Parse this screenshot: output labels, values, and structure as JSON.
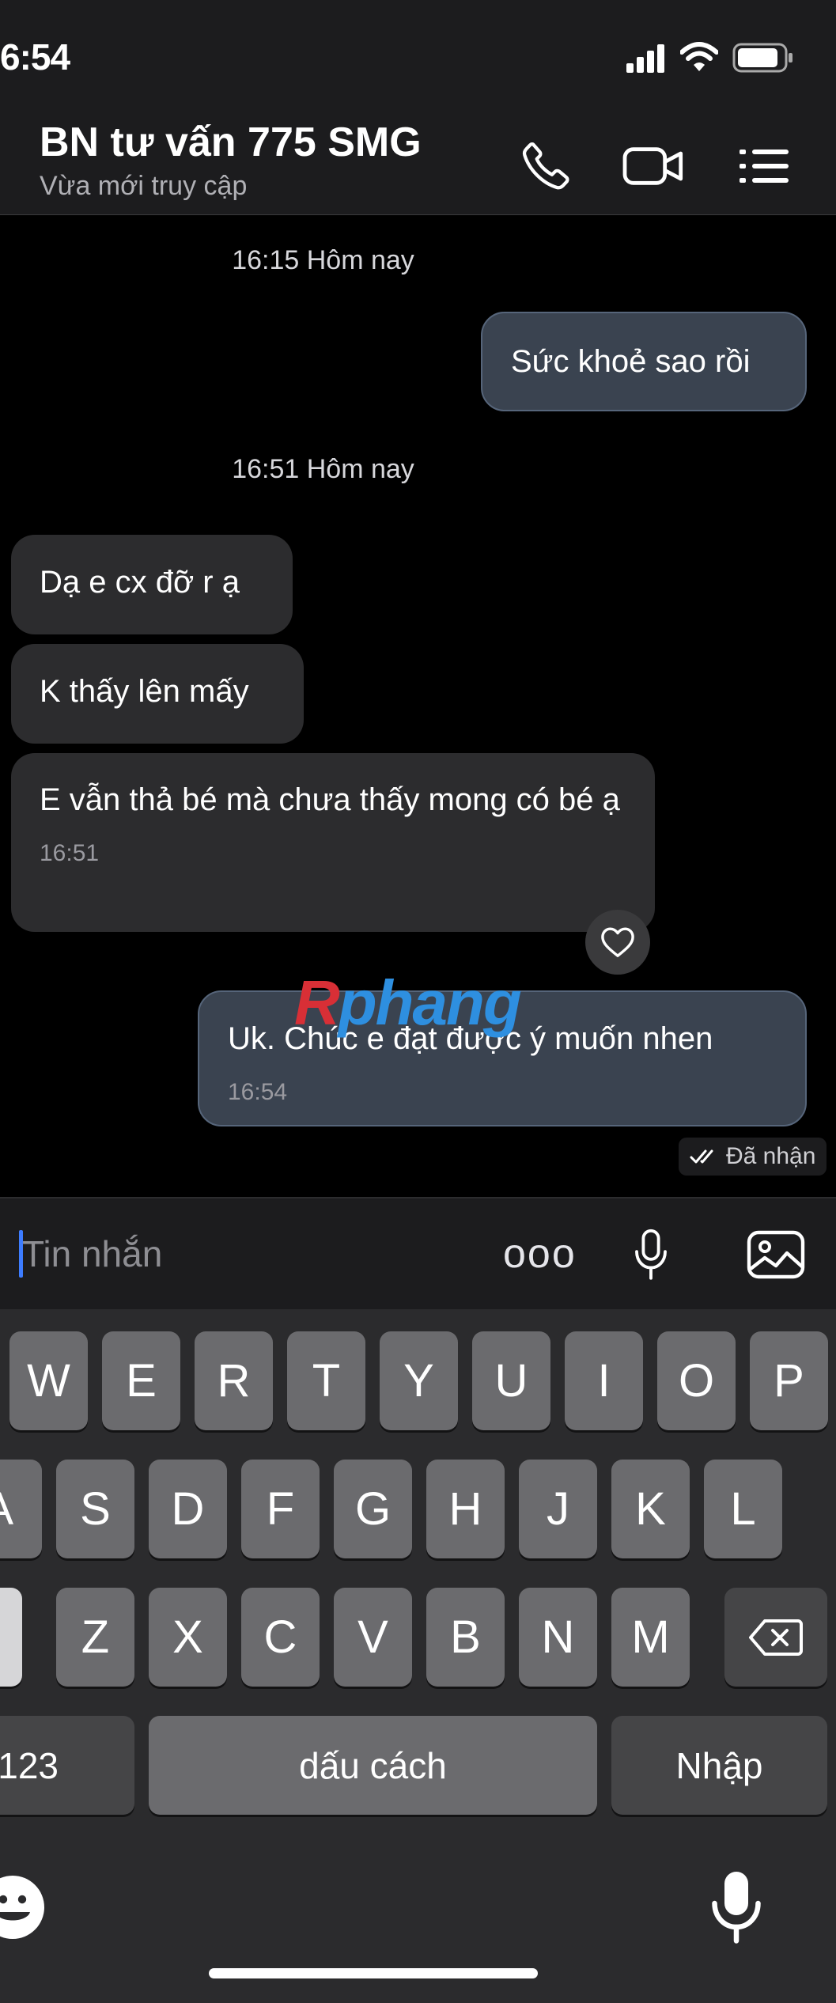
{
  "status_bar": {
    "time": "6:54"
  },
  "header": {
    "title": "BN tư vấn 775 SMG",
    "subtitle": "Vừa mới truy cập"
  },
  "messages": {
    "ts1": "16:15 Hôm nay",
    "out1": "Sức khoẻ sao rồi",
    "ts2": "16:51 Hôm nay",
    "in1": "Dạ e cx đỡ r ạ",
    "in2": "K thấy lên mấy",
    "in3": "E vẫn thả bé mà chưa thấy mong có bé ạ",
    "in3_time": "16:51",
    "out2": "Uk. Chúc e đạt được ý muốn nhen",
    "out2_time": "16:54",
    "receipt": "Đã nhận"
  },
  "watermark": {
    "part1": "R",
    "part2": "phang"
  },
  "composer": {
    "placeholder": "Tin nhắn",
    "more": "ooo"
  },
  "keyboard": {
    "row1": [
      "W",
      "E",
      "R",
      "T",
      "Y",
      "U",
      "I",
      "O",
      "P"
    ],
    "row2": [
      "A",
      "S",
      "D",
      "F",
      "G",
      "H",
      "J",
      "K",
      "L"
    ],
    "row3": [
      "Z",
      "X",
      "C",
      "V",
      "B",
      "N",
      "M"
    ],
    "numbers": "123",
    "space": "dấu cách",
    "enter": "Nhập"
  },
  "colors": {
    "background": "#000000",
    "bar": "#1c1c1e",
    "incoming_bubble": "#2c2c2e",
    "outgoing_bubble": "#3a4350",
    "key": "#6b6b6e",
    "caret": "#3d7cff"
  }
}
